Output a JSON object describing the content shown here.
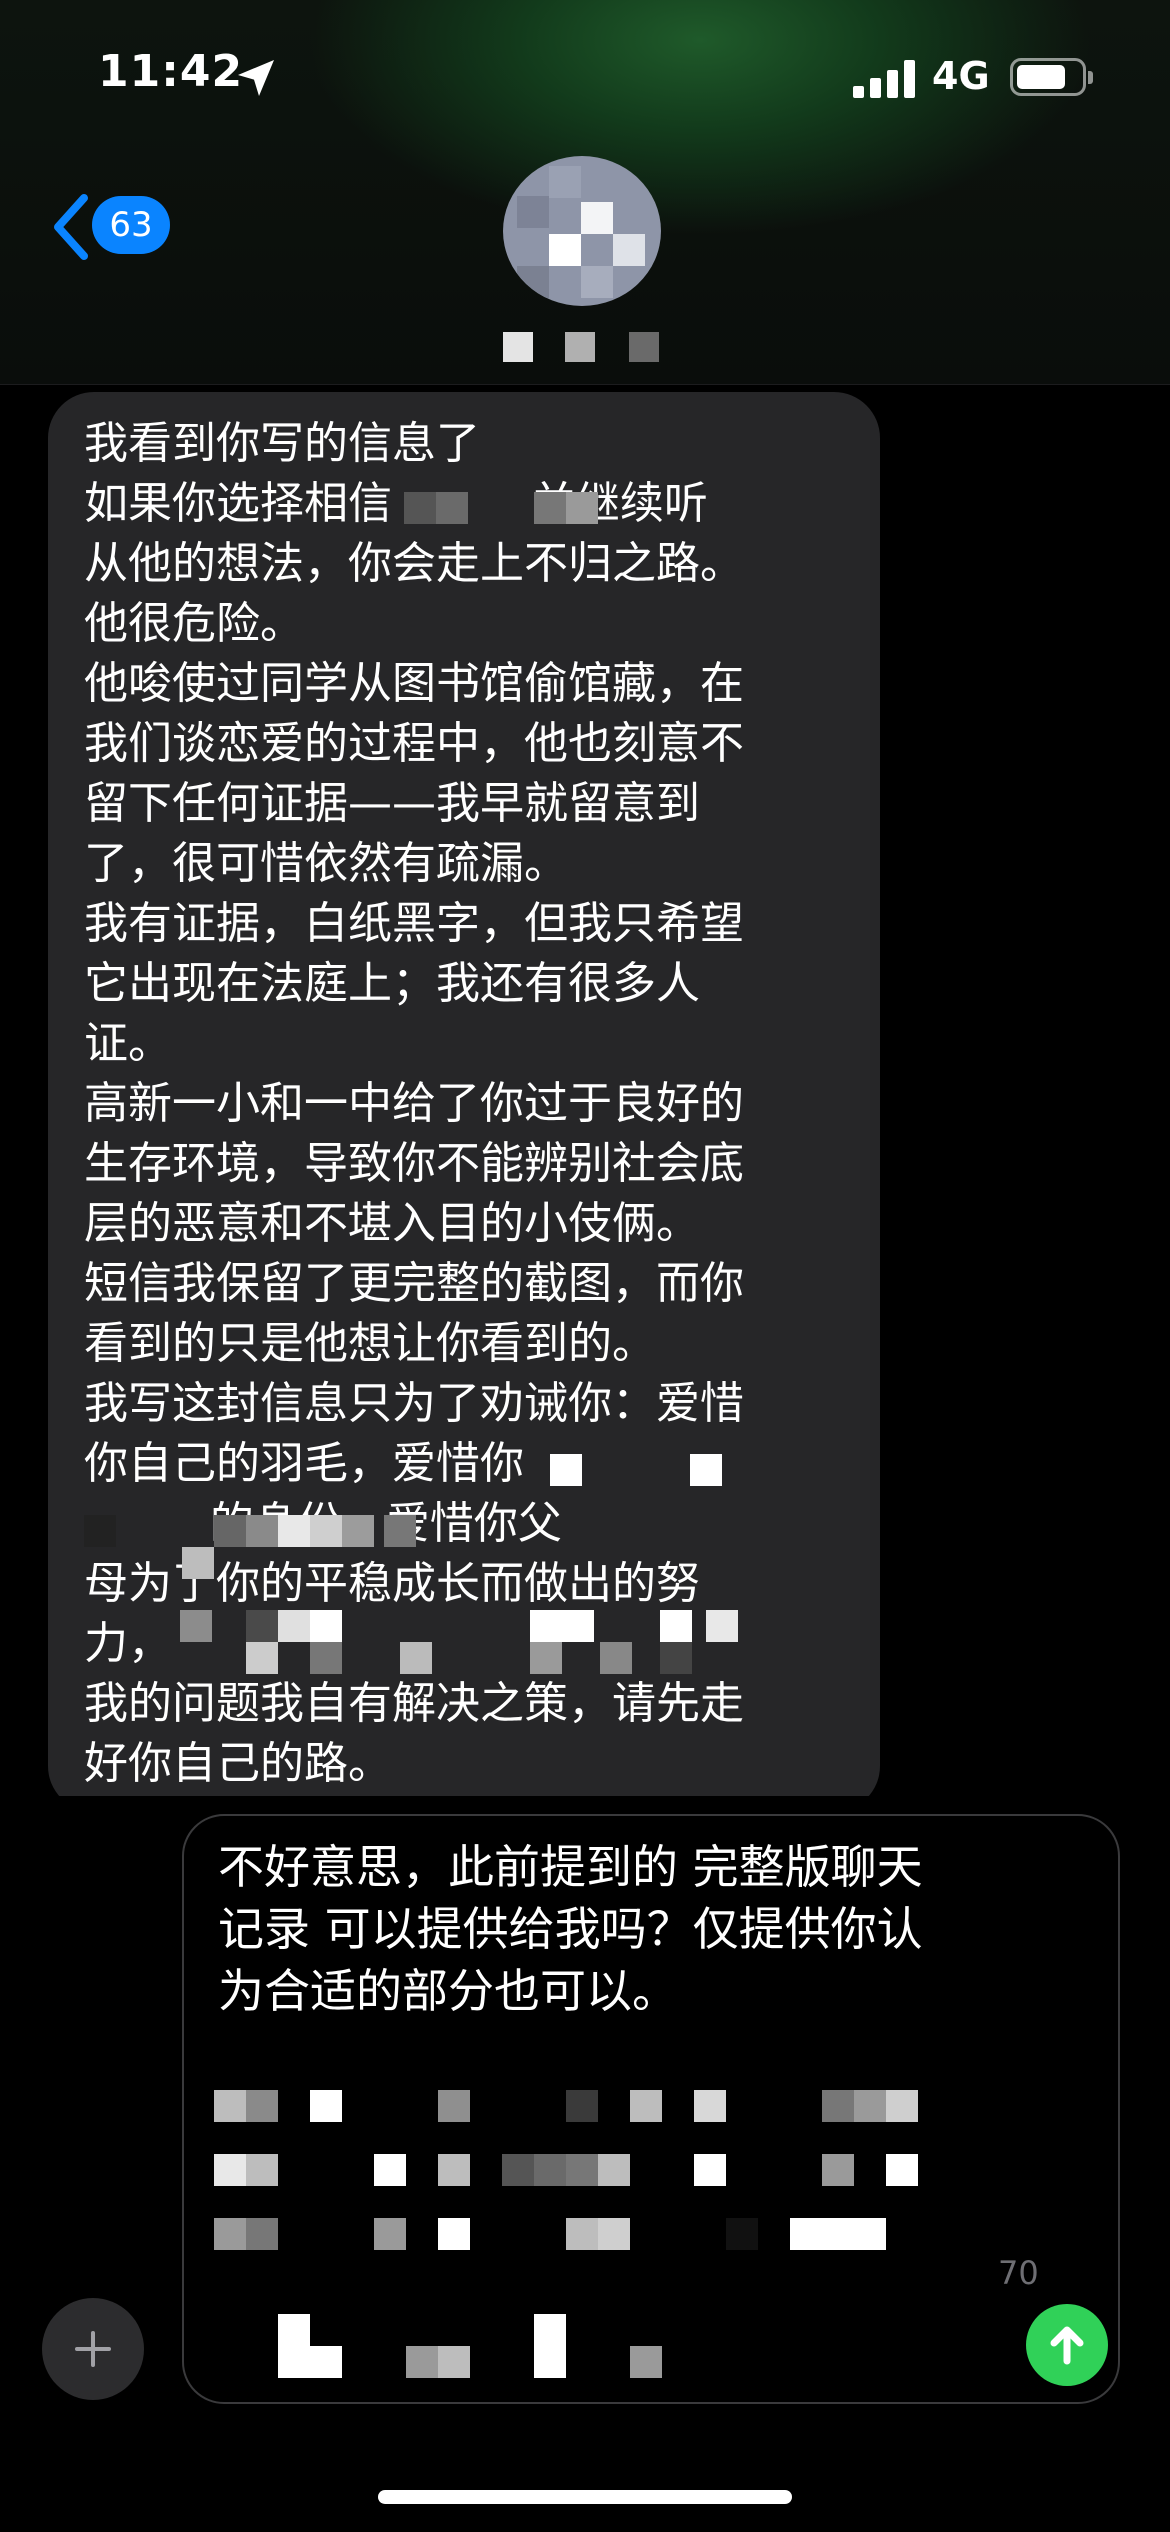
{
  "status_bar": {
    "time": "11:42",
    "network": "4G",
    "icons": [
      "location-arrow-icon",
      "signal-icon",
      "battery-icon"
    ]
  },
  "nav": {
    "unread_count": "63",
    "back_icon": "chevron-left-icon"
  },
  "messages": [
    {
      "direction": "incoming",
      "text": "我看到你写的信息了\n如果你选择相信          并继续听\n从他的想法，你会走上不归之路。\n他很危险。\n他唆使过同学从图书馆偷馆藏，在\n我们谈恋爱的过程中，他也刻意不\n留下任何证据——我早就留意到\n了，很可惜依然有疏漏。\n我有证据，白纸黑字，但我只希望\n它出现在法庭上；我还有很多人\n证。\n高新一小和一中给了你过于良好的\n生存环境，导致你不能辨别社会底\n层的恶意和不堪入目的小伎俩。\n短信我保留了更完整的截图，而你\n看到的只是他想让你看到的。\n我写这封信息只为了劝诫你：爱惜\n你自己的羽毛，爱惜你\n         的身份，爱惜你父\n母为了你的平稳成长而做出的努\n力，\n我的问题我自有解决之策，请先走\n好你自己的路。"
    }
  ],
  "composer": {
    "draft_text": "不好意思，此前提到的 完整版聊天\n记录 可以提供给我吗？仅提供你认\n为合适的部分也可以。",
    "char_count": "70",
    "add_icon": "plus-icon",
    "send_icon": "arrow-up-icon"
  },
  "colors": {
    "bubble_incoming": "#262628",
    "badge": "#0a84ff",
    "send": "#30d158",
    "background": "#000000"
  }
}
